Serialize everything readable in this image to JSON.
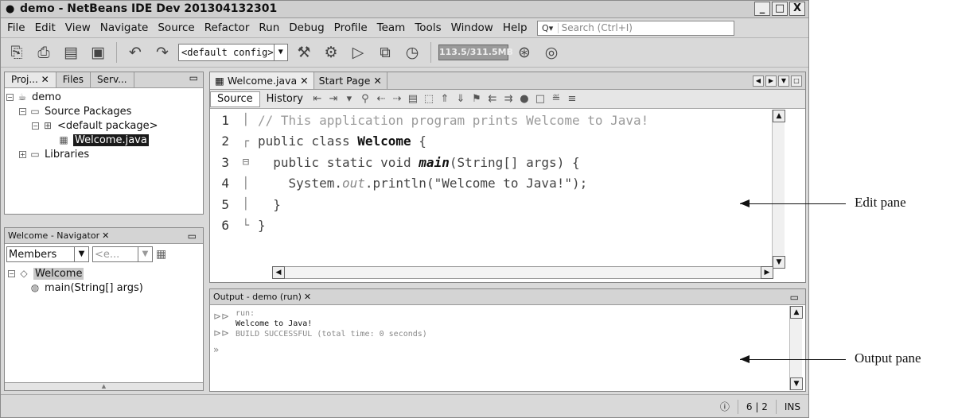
{
  "window": {
    "title": "demo - NetBeans IDE Dev 201304132301",
    "buttons": [
      "_",
      "□",
      "X"
    ]
  },
  "menubar": {
    "items": [
      "File",
      "Edit",
      "View",
      "Navigate",
      "Source",
      "Refactor",
      "Run",
      "Debug",
      "Profile",
      "Team",
      "Tools",
      "Window",
      "Help"
    ],
    "search_placeholder": "Search (Ctrl+I)"
  },
  "toolbar": {
    "config": "<default config>",
    "memory": "113.5/311.5MB"
  },
  "projects": {
    "tabs": [
      "Proj...",
      "Files",
      "Serv..."
    ],
    "tree": {
      "project": "demo",
      "source_packages": "Source Packages",
      "default_package": "<default package>",
      "file": "Welcome.java",
      "libraries": "Libraries"
    }
  },
  "navigator": {
    "title": "Welcome - Navigator",
    "filter": "Members",
    "filter2": "<e...",
    "class": "Welcome",
    "method": "main(String[] args)"
  },
  "editor": {
    "tabs": [
      "Welcome.java",
      "Start Page"
    ],
    "modes": [
      "Source",
      "History"
    ],
    "lines": [
      {
        "n": "1",
        "parts": [
          {
            "t": "// This application program prints Welcome to Java!",
            "c": "cmt"
          }
        ]
      },
      {
        "n": "2",
        "parts": [
          {
            "t": "public class ",
            "c": "kw"
          },
          {
            "t": "Welcome",
            "c": "bold"
          },
          {
            "t": " {",
            "c": "kw"
          }
        ]
      },
      {
        "n": "3",
        "parts": [
          {
            "t": "  public static void ",
            "c": "kw"
          },
          {
            "t": "main",
            "c": "bold italic"
          },
          {
            "t": "(String[] args) {",
            "c": "kw"
          }
        ]
      },
      {
        "n": "4",
        "parts": [
          {
            "t": "    System.",
            "c": "kw"
          },
          {
            "t": "out",
            "c": "italic gray"
          },
          {
            "t": ".println(\"Welcome to Java!\");",
            "c": "kw"
          }
        ]
      },
      {
        "n": "5",
        "parts": [
          {
            "t": "  }",
            "c": "kw"
          }
        ]
      },
      {
        "n": "6",
        "parts": [
          {
            "t": "}",
            "c": "kw"
          }
        ]
      }
    ]
  },
  "output": {
    "title": "Output - demo (run)",
    "lines": [
      "run:",
      "Welcome to Java!",
      "BUILD SUCCESSFUL (total time: 0 seconds)"
    ]
  },
  "status": {
    "position": "6 | 2",
    "mode": "INS"
  },
  "annotations": {
    "edit_pane": "Edit pane",
    "output_pane": "Output pane"
  }
}
